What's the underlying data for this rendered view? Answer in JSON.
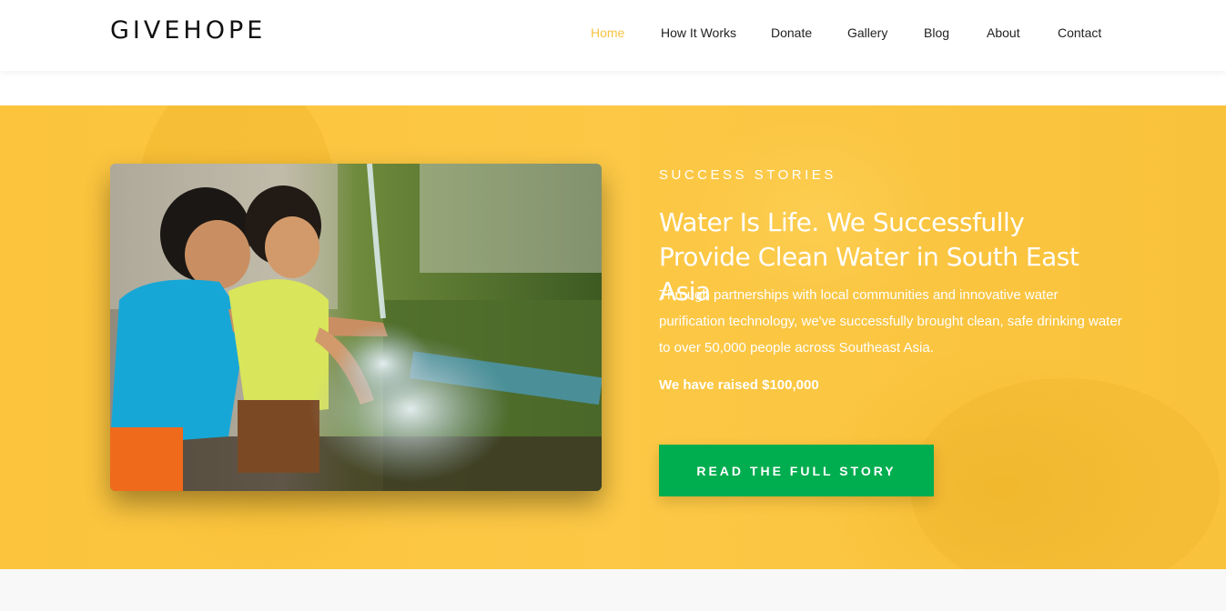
{
  "brand": {
    "logo_text": "GIVEHOPE"
  },
  "nav": {
    "items": [
      {
        "label": "Home",
        "active": true
      },
      {
        "label": "How It Works",
        "active": false
      },
      {
        "label": "Donate",
        "active": false
      },
      {
        "label": "Gallery",
        "active": false
      },
      {
        "label": "Blog",
        "active": false
      },
      {
        "label": "About",
        "active": false
      },
      {
        "label": "Contact",
        "active": false
      }
    ]
  },
  "hero": {
    "eyebrow": "Success Stories",
    "headline": "Water Is Life. We Successfully Provide Clean Water in South East Asia",
    "description": "Through partnerships with local communities and innovative water purification technology, we've successfully brought clean, safe drinking water to over 50,000 people across Southeast Asia.",
    "raised": "We have raised $100,000",
    "cta_label": "Read the Full Story",
    "photo_subject": "children-playing-with-water"
  },
  "colors": {
    "accent": "#f6c344",
    "hero_background": "#fcc845",
    "cta_background": "#00ad4f",
    "text_dark": "#222222"
  }
}
